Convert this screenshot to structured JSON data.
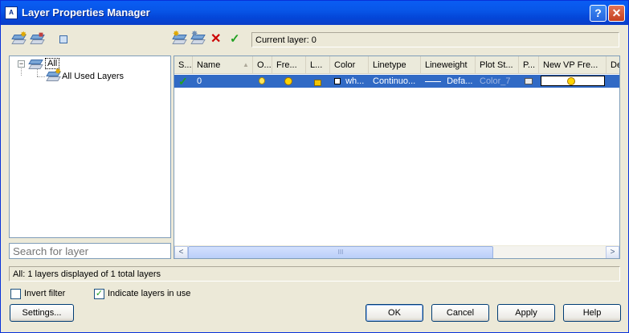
{
  "window": {
    "title": "Layer Properties Manager",
    "help_glyph": "?",
    "close_glyph": "✕"
  },
  "toolbar_left": {
    "icons": [
      "new-property-filter-icon",
      "new-group-filter-icon",
      "layer-states-manager-icon"
    ]
  },
  "toolbar_right": {
    "icons": [
      "new-layer-icon",
      "new-layer-vp-frozen-icon",
      "delete-layer-icon",
      "set-current-icon"
    ],
    "current_layer_label": "Current layer: 0"
  },
  "tree": {
    "expander": "−",
    "root": "All",
    "child": "All Used Layers"
  },
  "search": {
    "placeholder": "Search for layer"
  },
  "grid": {
    "columns": [
      "S...",
      "Name",
      "O...",
      "Fre...",
      "L...",
      "Color",
      "Linetype",
      "Lineweight",
      "Plot St...",
      "P...",
      "New VP Fre...",
      "De"
    ],
    "row": {
      "status": "✓",
      "name": "0",
      "color": "wh...",
      "linetype": "Continuo...",
      "lineweight": "Defa...",
      "plot_style": "Color_7"
    },
    "scroll_left": "<",
    "scroll_right": ">",
    "thumb_grip": "III"
  },
  "status_bar": "All: 1 layers displayed of 1 total layers",
  "options": {
    "invert_filter": {
      "label": "Invert filter",
      "checked": false
    },
    "indicate_layers_in_use": {
      "label": "Indicate layers in use",
      "checked": true,
      "mark": "✓"
    }
  },
  "buttons": {
    "settings": "Settings...",
    "ok": "OK",
    "cancel": "Cancel",
    "apply": "Apply",
    "help": "Help"
  },
  "colors": {
    "titlebar": "#0a5df3",
    "selection": "#316ac5",
    "face": "#ece9d8",
    "current_check": "#21a121",
    "delete_x": "#cc0000"
  }
}
